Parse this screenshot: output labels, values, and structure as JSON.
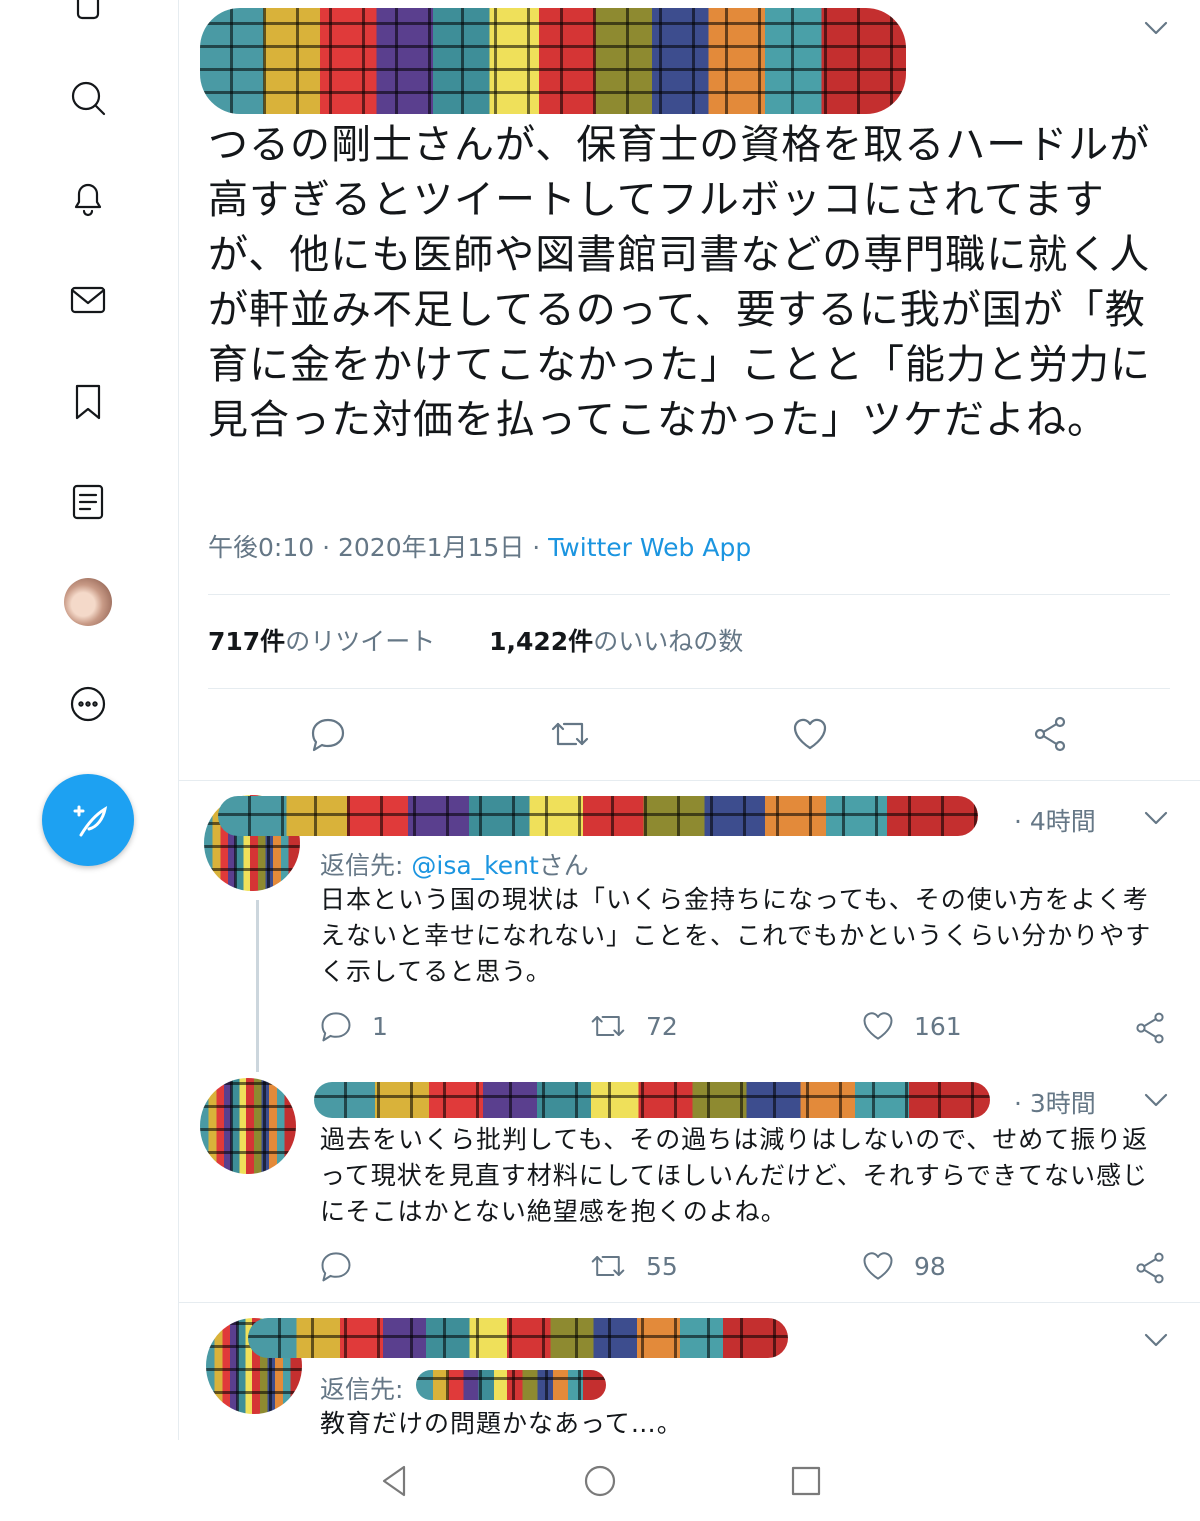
{
  "tweet": {
    "text": "つるの剛士さんが、保育士の資格を取るハードルが高すぎるとツイートしてフルボッコにされてますが、他にも医師や図書館司書などの専門職に就く人が軒並み不足してるのって、要するに我が国が「教育に金をかけてこなかった」ことと「能力と労力に見合った対価を払ってこなかった」ツケだよね。",
    "timestamp": "午後0:10 · 2020年1月15日 ·",
    "source_app": "Twitter Web App",
    "retweet_count": "717件",
    "retweet_label": "のリツイート",
    "like_count": "1,422件",
    "like_label": "のいいねの数"
  },
  "replies": [
    {
      "time": "· 4時間",
      "reply_to_label": "返信先: ",
      "reply_to_handle": "@isa_kent",
      "reply_to_suffix": "さん",
      "text": "日本という国の現状は「いくら金持ちになっても、その使い方をよく考えないと幸せになれない」ことを、これでもかというくらい分かりやすく示してると思う。",
      "reply_count": "1",
      "retweet_count": "72",
      "like_count": "161"
    },
    {
      "time": "· 3時間",
      "text": "過去をいくら批判しても、その過ちは減りはしないので、せめて振り返って現状を見直す材料にしてほしいんだけど、それすらできてない感じにそこはかとない絶望感を抱くのよね。",
      "reply_count": "",
      "retweet_count": "55",
      "like_count": "98"
    },
    {
      "reply_to_label": "返信先:",
      "text": "教育だけの問題かなあって…。"
    }
  ],
  "sidebar": {
    "icons": [
      "search-icon",
      "bell-icon",
      "mail-icon",
      "bookmark-icon",
      "list-icon",
      "profile-avatar",
      "more-icon",
      "compose-icon"
    ]
  },
  "colors": {
    "accent": "#1da1f2",
    "link": "#1b95e0",
    "secondary_text": "#657786"
  }
}
